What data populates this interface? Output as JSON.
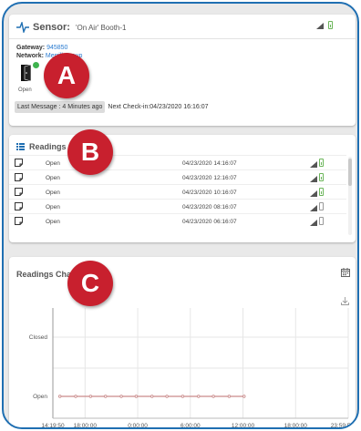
{
  "sensor": {
    "label": "Sensor:",
    "name": "'On Air' Booth-1",
    "gateway_label": "Gateway:",
    "gateway_value": "945850",
    "network_label": "Network:",
    "network_value": "Merrill Group",
    "state": "Open",
    "last_message": "Last Message : 4 Minutes ago",
    "next_checkin": "Next Check-in:04/23/2020 16:16:07"
  },
  "readings": {
    "title": "Readings",
    "rows": [
      {
        "status": "Open",
        "time": "04/23/2020 14:16:07",
        "battery": "green"
      },
      {
        "status": "Open",
        "time": "04/23/2020 12:16:07",
        "battery": "green"
      },
      {
        "status": "Open",
        "time": "04/23/2020 10:16:07",
        "battery": "green"
      },
      {
        "status": "Open",
        "time": "04/23/2020 08:16:07",
        "battery": "gray"
      },
      {
        "status": "Open",
        "time": "04/23/2020 06:16:07",
        "battery": "gray"
      }
    ]
  },
  "chart_section": {
    "title": "Readings Chart"
  },
  "markers": {
    "a": "A",
    "b": "B",
    "c": "C"
  },
  "icons": {
    "sensor": "pulse-icon",
    "readings": "list-icon",
    "calendar": "calendar-icon",
    "download": "download-icon",
    "door": "door-icon",
    "signal": "signal-icon",
    "battery": "battery-icon"
  },
  "colors": {
    "frame": "#1f6fb2",
    "link": "#2a7bd0",
    "marker": "#c8202e",
    "series": "#c98a8a",
    "status_ok": "#3fb34f"
  },
  "chart_data": {
    "type": "line",
    "categories_y": [
      "Closed",
      "Open"
    ],
    "x_tick_labels": [
      "14:19:50",
      "18:00:00",
      "0:00:00",
      "6:00:00",
      "12:00:00",
      "18:00:00",
      "23:59:59"
    ],
    "x_tick_hours": [
      0,
      3.67,
      9.67,
      15.67,
      21.67,
      27.67,
      33.67
    ],
    "series": [
      {
        "values_x_hours": [
          0.8,
          2.6,
          4.3,
          6.0,
          7.8,
          9.5,
          11.3,
          13.0,
          14.8,
          16.6,
          18.3,
          20.1,
          21.8
        ],
        "values_y": [
          "Open",
          "Open",
          "Open",
          "Open",
          "Open",
          "Open",
          "Open",
          "Open",
          "Open",
          "Open",
          "Open",
          "Open",
          "Open"
        ]
      }
    ],
    "xlim_hours": [
      0,
      33.67
    ],
    "grid": true
  }
}
